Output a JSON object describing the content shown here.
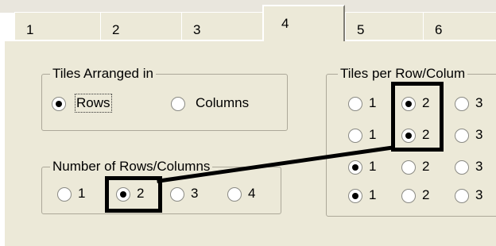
{
  "tabs": [
    {
      "label": "1"
    },
    {
      "label": "2"
    },
    {
      "label": "3"
    },
    {
      "label": "4",
      "active": true
    },
    {
      "label": "5"
    },
    {
      "label": "6"
    }
  ],
  "arranged": {
    "title": "Tiles Arranged in",
    "options": [
      {
        "label": "Rows",
        "checked": true
      },
      {
        "label": "Columns",
        "checked": false
      }
    ]
  },
  "number": {
    "title": "Number of Rows/Columns",
    "options": [
      {
        "label": "1",
        "checked": false
      },
      {
        "label": "2",
        "checked": true
      },
      {
        "label": "3",
        "checked": false
      },
      {
        "label": "4",
        "checked": false
      }
    ]
  },
  "perrow": {
    "title": "Tiles per Row/Colum",
    "rows": [
      [
        {
          "label": "1",
          "checked": false
        },
        {
          "label": "2",
          "checked": true
        },
        {
          "label": "3",
          "checked": false
        }
      ],
      [
        {
          "label": "1",
          "checked": false
        },
        {
          "label": "2",
          "checked": true
        },
        {
          "label": "3",
          "checked": false
        }
      ],
      [
        {
          "label": "1",
          "checked": true
        },
        {
          "label": "2",
          "checked": false
        },
        {
          "label": "3",
          "checked": false
        }
      ],
      [
        {
          "label": "1",
          "checked": true
        },
        {
          "label": "2",
          "checked": false
        },
        {
          "label": "3",
          "checked": false
        }
      ]
    ]
  }
}
